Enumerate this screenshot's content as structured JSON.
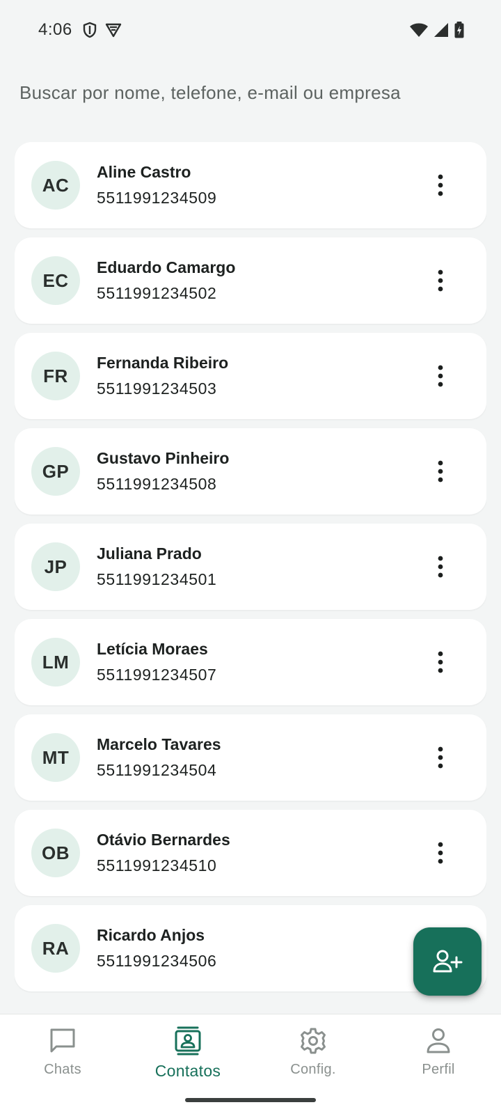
{
  "status_bar": {
    "time": "4:06",
    "icons_left": [
      "shield-icon",
      "vpn-badge-icon"
    ],
    "icons_right": [
      "wifi-icon",
      "cellular-signal-icon",
      "battery-charging-icon"
    ]
  },
  "search": {
    "placeholder": "Buscar por nome, telefone, e-mail ou empresa",
    "value": ""
  },
  "contacts": [
    {
      "initials": "AC",
      "name": "Aline Castro",
      "phone": "5511991234509"
    },
    {
      "initials": "EC",
      "name": "Eduardo Camargo",
      "phone": "5511991234502"
    },
    {
      "initials": "FR",
      "name": "Fernanda Ribeiro",
      "phone": "5511991234503"
    },
    {
      "initials": "GP",
      "name": "Gustavo Pinheiro",
      "phone": "5511991234508"
    },
    {
      "initials": "JP",
      "name": "Juliana Prado",
      "phone": "5511991234501"
    },
    {
      "initials": "LM",
      "name": "Letícia Moraes",
      "phone": "5511991234507"
    },
    {
      "initials": "MT",
      "name": "Marcelo Tavares",
      "phone": "5511991234504"
    },
    {
      "initials": "OB",
      "name": "Otávio Bernardes",
      "phone": "5511991234510"
    },
    {
      "initials": "RA",
      "name": "Ricardo Anjos",
      "phone": "5511991234506"
    }
  ],
  "fab": {
    "icon": "add-person-icon"
  },
  "bottom_nav": {
    "items": [
      {
        "label": "Chats",
        "icon": "chat-bubble-icon",
        "active": false
      },
      {
        "label": "Contatos",
        "icon": "contacts-icon",
        "active": true
      },
      {
        "label": "Config.",
        "icon": "gear-icon",
        "active": false
      },
      {
        "label": "Perfil",
        "icon": "person-icon",
        "active": false
      }
    ]
  },
  "colors": {
    "accent": "#17705a",
    "avatar_bg": "#e2f0ea",
    "background": "#f3f5f5",
    "inactive": "#8a908e"
  }
}
